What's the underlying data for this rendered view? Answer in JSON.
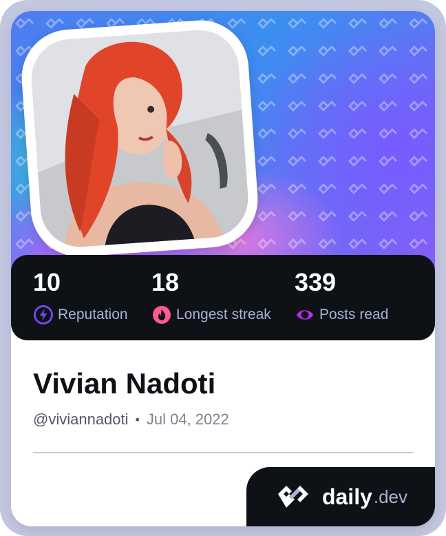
{
  "profile": {
    "name": "Vivian Nadoti",
    "handle": "@viviannadoti",
    "separator": "•",
    "joined": "Jul 04, 2022"
  },
  "stats": [
    {
      "value": "10",
      "label": "Reputation",
      "icon": "lightning-icon",
      "color": "#7147ed"
    },
    {
      "value": "18",
      "label": "Longest streak",
      "icon": "flame-icon",
      "color": "#ff5a8d"
    },
    {
      "value": "339",
      "label": "Posts read",
      "icon": "eye-ring-icon",
      "color": "#c029f0"
    }
  ],
  "brand": {
    "word": "daily",
    "tld": ".dev",
    "logo": "daily-dev-logo-icon"
  },
  "colors": {
    "dark": "#0e1217",
    "muted": "#a8b3cf",
    "frame": "#c3c7e0"
  }
}
